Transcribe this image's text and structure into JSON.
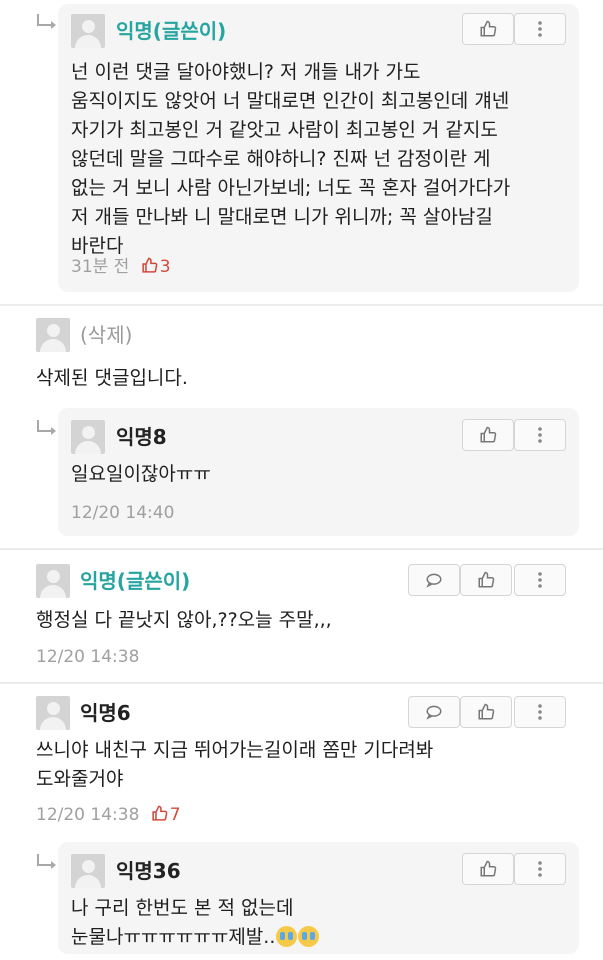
{
  "comments": [
    {
      "name": "익명(글쓴이)",
      "lines": [
        "넌 이런 댓글 달아야했니? 저 개들 내가 가도",
        "움직이지도 않앗어 너 말대로면 인간이 최고봉인데 걔넨",
        "자기가 최고봉인 거 같앗고 사람이 최고봉인 거 같지도",
        "않던데 말을 그따수로 해야하니? 진짜 넌 감정이란 게",
        "없는 거 보니 사람 아닌가보네; 너도 꼭 혼자 걸어가다가",
        "저 개들 만나봐 니 말대로면 니가 위니까; 꼭 살아남길",
        "바란다"
      ],
      "time": "31분 전",
      "likes": "3"
    },
    {
      "name": "(삭제)",
      "lines": [
        "삭제된 댓글입니다."
      ]
    },
    {
      "name": "익명8",
      "lines": [
        "일요일이잖아ㅠㅠ"
      ],
      "time": "12/20 14:40"
    },
    {
      "name": "익명(글쓴이)",
      "lines": [
        "행정실 다 끝낫지 않아,??오늘 주말,,,"
      ],
      "time": "12/20 14:38"
    },
    {
      "name": "익명6",
      "lines": [
        "쓰니야 내친구 지금 뛰어가는길이래 쫌만 기다려봐",
        "도와줄거야"
      ],
      "time": "12/20 14:38",
      "likes": "7"
    },
    {
      "name": "익명36",
      "lines": [
        "나 구리 한번도 본 적 없는데",
        "눈물나ㅠㅠㅠㅠㅠㅠ제발.."
      ]
    }
  ],
  "icons": {
    "like": "thumbs-up-icon",
    "more": "more-vertical-icon",
    "reply": "speech-bubble-icon",
    "crying": "crying-face-emoji"
  },
  "colors": {
    "author_name": "#26a5a0",
    "like_count": "#d34a3c",
    "meta": "#a0a0a0",
    "reply_background": "#f5f5f5"
  }
}
